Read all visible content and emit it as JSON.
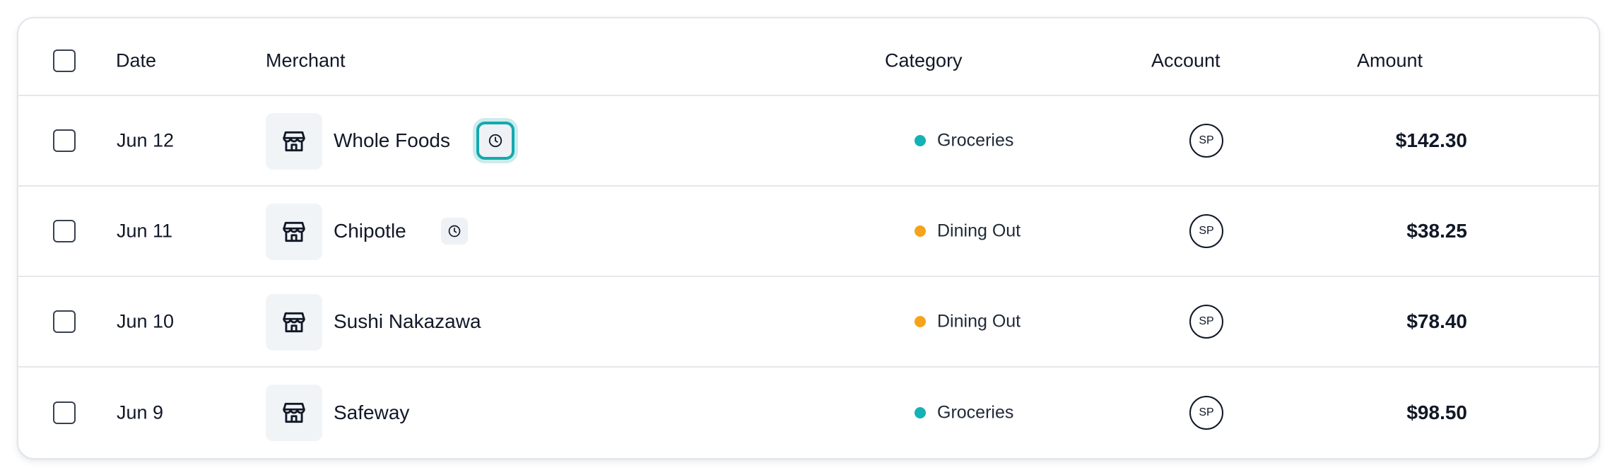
{
  "table": {
    "headers": {
      "date": "Date",
      "merchant": "Merchant",
      "category": "Category",
      "account": "Account",
      "amount": "Amount"
    },
    "rows": [
      {
        "date": "Jun 12",
        "merchant": "Whole Foods",
        "category": "Groceries",
        "category_color": "#14b1b6",
        "account": "SP",
        "amount": "$142.30",
        "pending": true,
        "pending_focused": true
      },
      {
        "date": "Jun 11",
        "merchant": "Chipotle",
        "category": "Dining Out",
        "category_color": "#f5a31b",
        "account": "SP",
        "amount": "$38.25",
        "pending": true,
        "pending_focused": false
      },
      {
        "date": "Jun 10",
        "merchant": "Sushi Nakazawa",
        "category": "Dining Out",
        "category_color": "#f5a31b",
        "account": "SP",
        "amount": "$78.40",
        "pending": false
      },
      {
        "date": "Jun 9",
        "merchant": "Safeway",
        "category": "Groceries",
        "category_color": "#14b1b6",
        "account": "SP",
        "amount": "$98.50",
        "pending": false
      }
    ]
  },
  "icons": {
    "merchant": "storefront-icon",
    "pending": "clock-icon"
  },
  "colors": {
    "focus_ring": "#14a9ae",
    "groceries": "#14b1b6",
    "dining_out": "#f5a31b"
  }
}
